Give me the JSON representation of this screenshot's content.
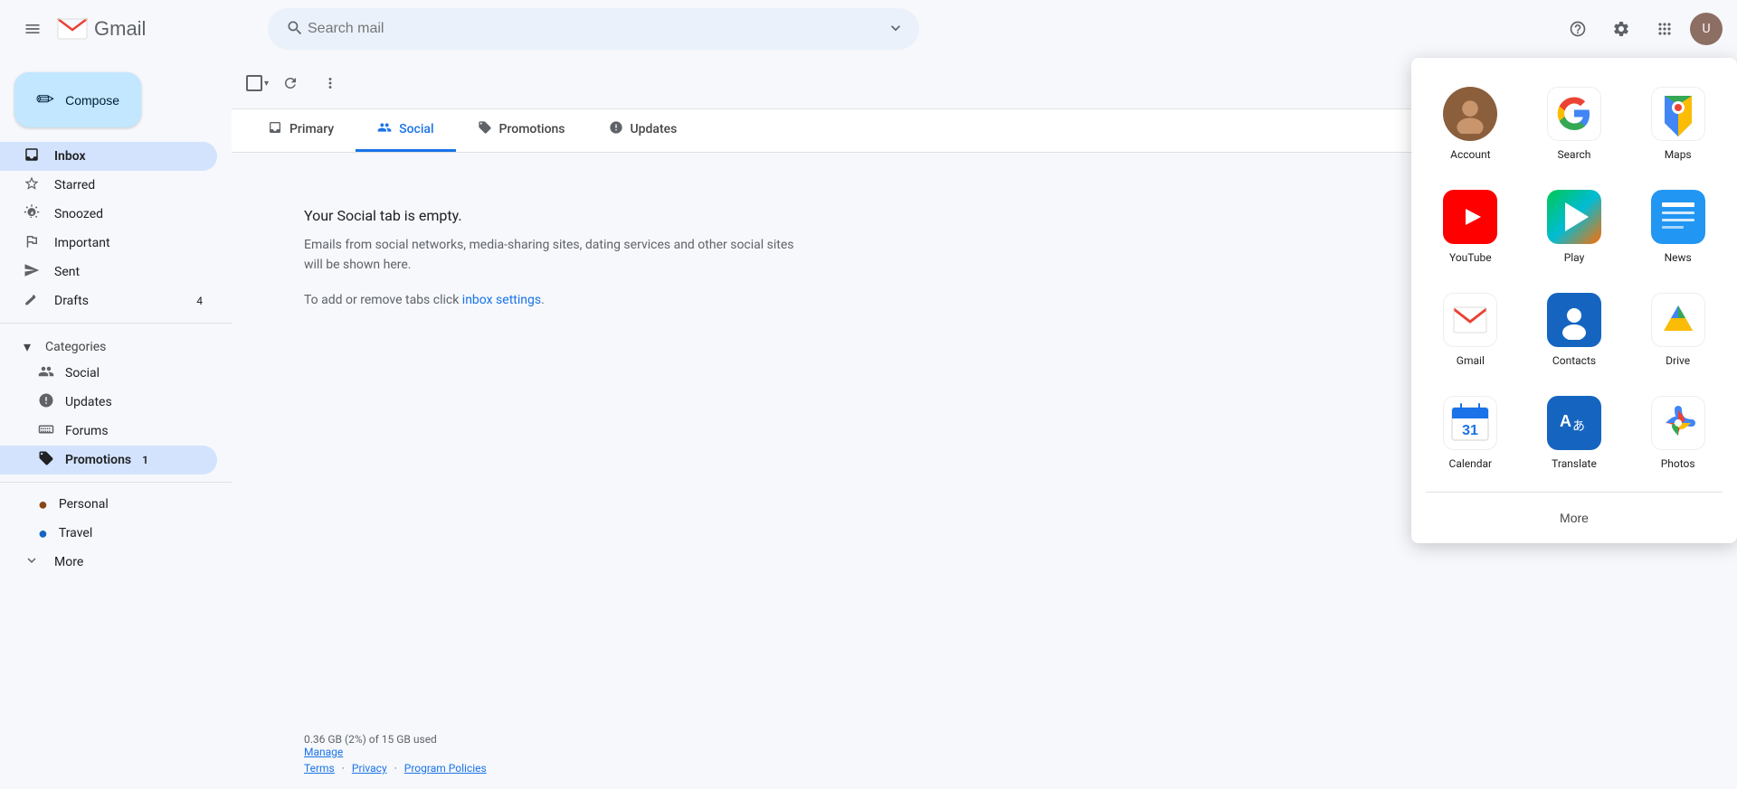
{
  "topbar": {
    "search_placeholder": "Search mail",
    "app_name": "Gmail",
    "hamburger_label": "Main menu"
  },
  "compose": {
    "label": "Compose"
  },
  "sidebar": {
    "items": [
      {
        "id": "inbox",
        "label": "Inbox",
        "icon": "inbox",
        "count": "",
        "active": true
      },
      {
        "id": "starred",
        "label": "Starred",
        "icon": "star",
        "count": ""
      },
      {
        "id": "snoozed",
        "label": "Snoozed",
        "icon": "snooze",
        "count": ""
      },
      {
        "id": "important",
        "label": "Important",
        "icon": "label-important",
        "count": ""
      },
      {
        "id": "sent",
        "label": "Sent",
        "icon": "send",
        "count": ""
      },
      {
        "id": "drafts",
        "label": "Drafts",
        "icon": "drafts",
        "count": "4"
      }
    ],
    "categories_label": "Categories",
    "categories": [
      {
        "id": "social",
        "label": "Social",
        "icon": "people"
      },
      {
        "id": "updates",
        "label": "Updates",
        "icon": "info"
      },
      {
        "id": "forums",
        "label": "Forums",
        "icon": "forum"
      },
      {
        "id": "promotions",
        "label": "Promotions",
        "icon": "local-offer",
        "count": "1",
        "active": true
      }
    ],
    "labels": [
      {
        "id": "personal",
        "label": "Personal",
        "icon": "label"
      },
      {
        "id": "travel",
        "label": "Travel",
        "icon": "label"
      }
    ],
    "more_label": "More"
  },
  "tabs": [
    {
      "id": "primary",
      "label": "Primary",
      "icon": "inbox"
    },
    {
      "id": "social",
      "label": "Social",
      "icon": "people",
      "active": true
    },
    {
      "id": "promotions",
      "label": "Promotions",
      "icon": "local-offer"
    },
    {
      "id": "updates",
      "label": "Updates",
      "icon": "info"
    }
  ],
  "empty_state": {
    "title": "Your Social tab is empty.",
    "description": "Emails from social networks, media-sharing sites, dating services and other social sites will be shown here.",
    "link_text": "inbox settings",
    "link_prefix": "To add or remove tabs click ",
    "link_suffix": "."
  },
  "footer": {
    "storage": "0.36 GB (2%) of 15 GB used",
    "manage": "Manage",
    "terms": "Terms",
    "privacy": "Privacy",
    "program_policies": "Program Policies"
  },
  "apps_panel": {
    "apps": [
      {
        "id": "account",
        "label": "Account",
        "type": "avatar"
      },
      {
        "id": "search",
        "label": "Search",
        "type": "google"
      },
      {
        "id": "maps",
        "label": "Maps",
        "type": "maps"
      },
      {
        "id": "youtube",
        "label": "YouTube",
        "type": "youtube"
      },
      {
        "id": "play",
        "label": "Play",
        "type": "play"
      },
      {
        "id": "news",
        "label": "News",
        "type": "news"
      },
      {
        "id": "gmail",
        "label": "Gmail",
        "type": "gmail"
      },
      {
        "id": "contacts",
        "label": "Contacts",
        "type": "contacts"
      },
      {
        "id": "drive",
        "label": "Drive",
        "type": "drive"
      },
      {
        "id": "calendar",
        "label": "Calendar",
        "type": "calendar"
      },
      {
        "id": "translate",
        "label": "Translate",
        "type": "translate"
      },
      {
        "id": "photos",
        "label": "Photos",
        "type": "photos"
      }
    ],
    "more_label": "More"
  }
}
